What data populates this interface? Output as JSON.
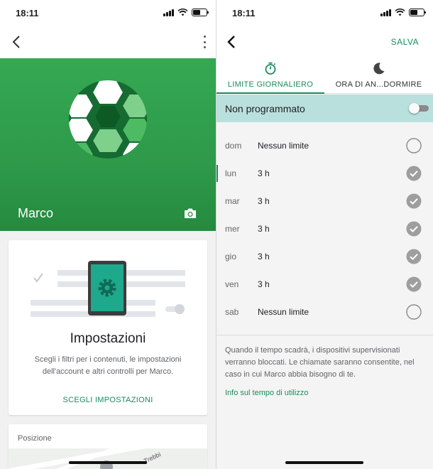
{
  "left_screen": {
    "status_time": "18:11",
    "profile_name": "Marco",
    "settings_card": {
      "title": "Impostazioni",
      "description": "Scegli i filtri per i contenuti, le impostazioni dell'account e altri controlli per Marco.",
      "link": "SCEGLI IMPOSTAZIONI"
    },
    "position_card": {
      "label": "Posizione",
      "map_label": "Trebbi"
    },
    "hero_color": "#2e9a4a"
  },
  "right_screen": {
    "status_time": "18:11",
    "save_label": "SALVA",
    "tabs": [
      {
        "label": "LIMITE GIORNALIERO",
        "icon": "timer-icon",
        "selected": true
      },
      {
        "label": "ORA DI AN...DORMIRE",
        "icon": "moon-icon",
        "selected": false
      }
    ],
    "schedule": {
      "label": "Non programmato",
      "enabled": false
    },
    "days": [
      {
        "day": "dom",
        "limit": "Nessun limite",
        "checked": false
      },
      {
        "day": "lun",
        "limit": "3 h",
        "checked": true
      },
      {
        "day": "mar",
        "limit": "3 h",
        "checked": true
      },
      {
        "day": "mer",
        "limit": "3 h",
        "checked": true
      },
      {
        "day": "gio",
        "limit": "3 h",
        "checked": true
      },
      {
        "day": "ven",
        "limit": "3 h",
        "checked": true
      },
      {
        "day": "sab",
        "limit": "Nessun limite",
        "checked": false
      }
    ],
    "info_text": "Quando il tempo scadrà, i dispositivi supervisionati verranno bloccati. Le chiamate saranno consentite, nel caso in cui Marco abbia bisogno di te.",
    "info_link": "Info sul tempo di utilizzo",
    "accent_color": "#1a8c5a"
  }
}
